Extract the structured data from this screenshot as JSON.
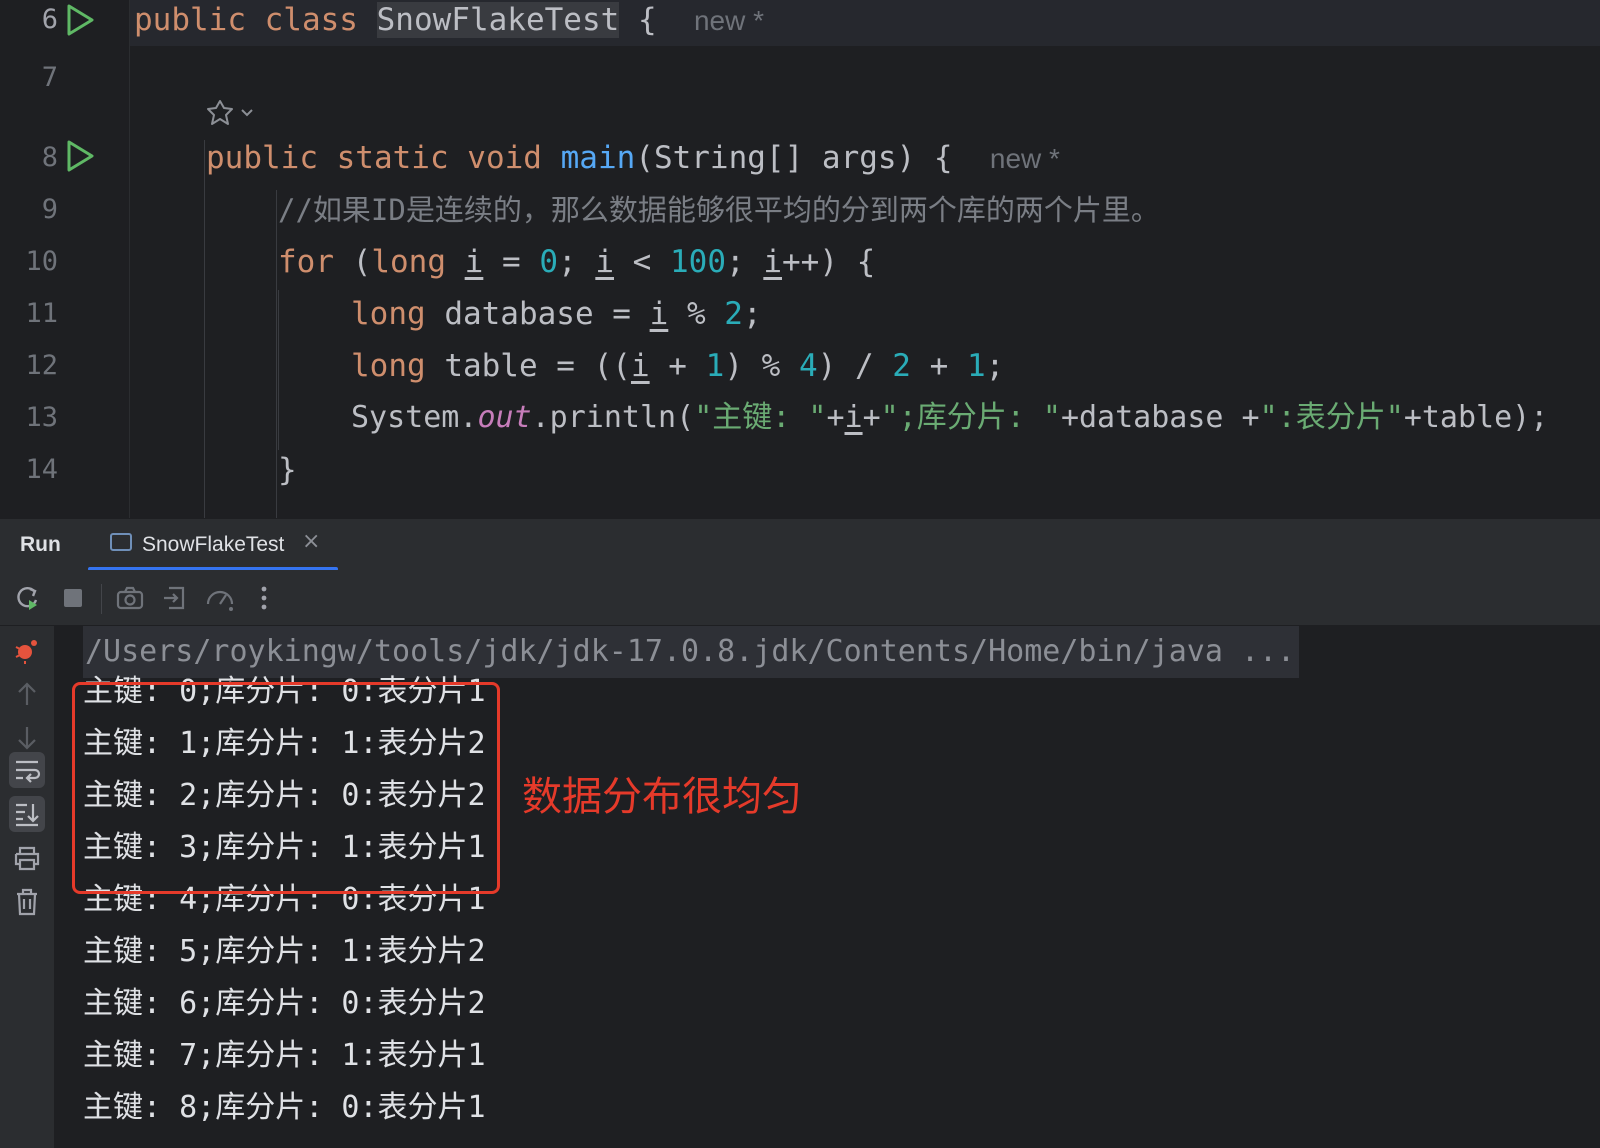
{
  "editor": {
    "lines": [
      {
        "num": "6",
        "run": true,
        "hint": "new *"
      },
      {
        "num": "7"
      },
      {
        "num": "8",
        "run": true,
        "hint": "new *"
      },
      {
        "num": "9",
        "comment": "//如果ID是连续的，那么数据能够很平均的分到两个库的两个片里。"
      },
      {
        "num": "10"
      },
      {
        "num": "11"
      },
      {
        "num": "12"
      },
      {
        "num": "13"
      },
      {
        "num": "14"
      }
    ],
    "class_decl": {
      "kw": "public class",
      "name": "SnowFlakeTest",
      "brace": "{"
    },
    "main_decl": {
      "kw": "public static void",
      "name": "main",
      "params": "(String[] args) {"
    },
    "for_line": {
      "kw": "for",
      "p1": " (",
      "kw2": "long",
      "v1": "i",
      "eq": " = ",
      "n0": "0",
      "sc1": "; ",
      "v2": "i",
      "lt": " < ",
      "n100": "100",
      "sc2": "; ",
      "v3": "i",
      "inc": "++) {"
    },
    "db_line": {
      "kw": "long",
      "rest1": " database = ",
      "v": "i",
      "mod": " % ",
      "n2": "2",
      "end": ";"
    },
    "table_line": {
      "kw": "long",
      "rest1": " table = ((",
      "v": "i",
      "plus": " + ",
      "n1": "1",
      "mod": ") % ",
      "n4": "4",
      "div": ") / ",
      "n2": "2",
      "plus2": " + ",
      "n1b": "1",
      "end": ";"
    },
    "print_line": {
      "sys": "System.",
      "out": "out",
      "println": ".println(",
      "s1": "\"主键: \"",
      "plus1": "+",
      "v": "i",
      "plus2": "+",
      "s2": "\";库分片: \"",
      "plus3": "+database +",
      "s3": "\":表分片\"",
      "tail": "+table);"
    },
    "close_brace": "}"
  },
  "run_window": {
    "title": "Run",
    "tab_label": "SnowFlakeTest",
    "tab_close": "×"
  },
  "console": {
    "command": "/Users/roykingw/tools/jdk/jdk-17.0.8.jdk/Contents/Home/bin/java ...",
    "output": [
      "主键: 0;库分片: 0:表分片1",
      "主键: 1;库分片: 1:表分片2",
      "主键: 2;库分片: 0:表分片2",
      "主键: 3;库分片: 1:表分片1",
      "主键: 4;库分片: 0:表分片1",
      "主键: 5;库分片: 1:表分片2",
      "主键: 6;库分片: 0:表分片2",
      "主键: 7;库分片: 1:表分片1",
      "主键: 8;库分片: 0:表分片1"
    ]
  },
  "annotation": {
    "text": "数据分布很均匀",
    "color": "#e53a2a"
  },
  "colors": {
    "keyword": "#cf8e6d",
    "number": "#2aacb8",
    "string": "#6aab73",
    "function": "#56a8f5",
    "static_field": "#c77dbb",
    "run_green": "#5fb865",
    "accent": "#3574f0"
  },
  "icons": {
    "toolbar": [
      "rerun-icon",
      "stop-icon",
      "camera-icon",
      "restore-layout-icon",
      "profiler-icon",
      "more-icon"
    ],
    "left_strip": [
      "debug-bug-icon",
      "arrow-up-icon",
      "arrow-down-icon",
      "soft-wrap-icon",
      "scroll-to-end-icon",
      "print-icon",
      "trash-icon"
    ]
  }
}
